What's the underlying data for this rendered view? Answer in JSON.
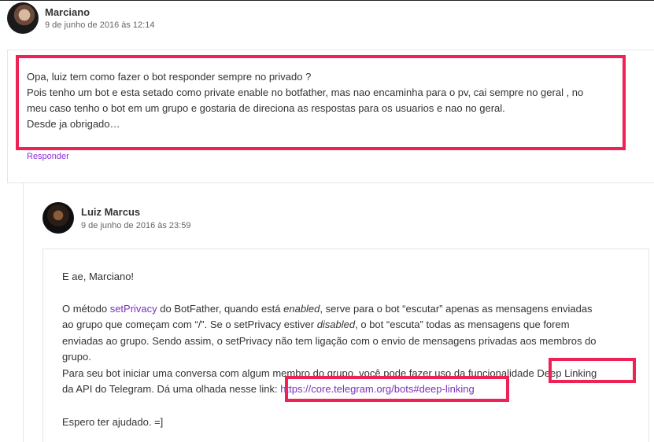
{
  "comment1": {
    "author": "Marciano",
    "date": "9 de junho de 2016 às 12:14",
    "lines": [
      "Opa, luiz tem como fazer o bot responder sempre no privado ?",
      "Pois tenho um bot e esta setado como private enable no botfather, mas nao encaminha para o pv, cai sempre no geral , no",
      "meu caso tenho o bot em um grupo e gostaria de direciona as respostas para os usuarios e nao no geral.",
      "Desde ja obrigado…"
    ],
    "reply_label": "Responder"
  },
  "comment2": {
    "author": "Luiz Marcus",
    "date": "9 de junho de 2016 às 23:59",
    "greeting": "E ae, Marciano!",
    "p1": {
      "a": "O método ",
      "link": "setPrivacy",
      "b": " do BotFather, quando está ",
      "c": "enabled",
      "d": ", serve para o bot “escutar” apenas as mensagens enviadas"
    },
    "p2": {
      "a": "ao grupo que começam com “/”. Se o setPrivacy estiver ",
      "b": "disabled",
      "c": ", o bot “escuta” todas as mensagens que forem"
    },
    "p3": "enviadas ao grupo. Sendo assim, o setPrivacy não tem ligação com o envio de mensagens privadas aos membros do",
    "p4": "grupo.",
    "p5": "Para seu bot iniciar uma conversa com algum membro do grupo, você pode fazer uso da funcionalidade Deep Linking",
    "p6": {
      "a": "da API do Telegram. Dá uma olhada nesse link: ",
      "link": "https://core.telegram.org/bots#deep-linking"
    },
    "closing": "Espero ter ajudado. =]"
  },
  "highlight_color": "#ee2255",
  "link_color": "#7b2fbe"
}
